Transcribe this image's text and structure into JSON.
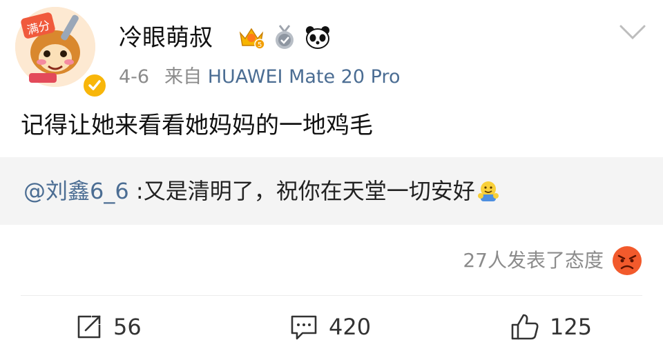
{
  "post": {
    "author": {
      "name": "冷眼萌叔"
    },
    "date": "4-6",
    "source_prefix": "来自",
    "source": "HUAWEI Mate 20 Pro",
    "text": "记得让她来看看她妈妈的一地鸡毛"
  },
  "repost": {
    "mention": "@刘鑫6_6",
    "separator": " :",
    "text": "又是清明了，祝你在天堂一切安好"
  },
  "reactions": {
    "label": "27人发表了态度"
  },
  "actions": {
    "repost_count": "56",
    "comment_count": "420",
    "like_count": "125"
  },
  "colors": {
    "link": "#4b6d93",
    "meta": "#8b8b8b",
    "repost_bg": "#f4f4f4",
    "verified": "#f8b60a"
  },
  "icons": [
    "avatar-icon",
    "verified-icon",
    "vip-crown-icon",
    "medal-icon",
    "panda-icon",
    "chevron-down-icon",
    "hug-emoji-icon",
    "angry-emoji-icon",
    "repost-icon",
    "comment-icon",
    "like-icon"
  ]
}
